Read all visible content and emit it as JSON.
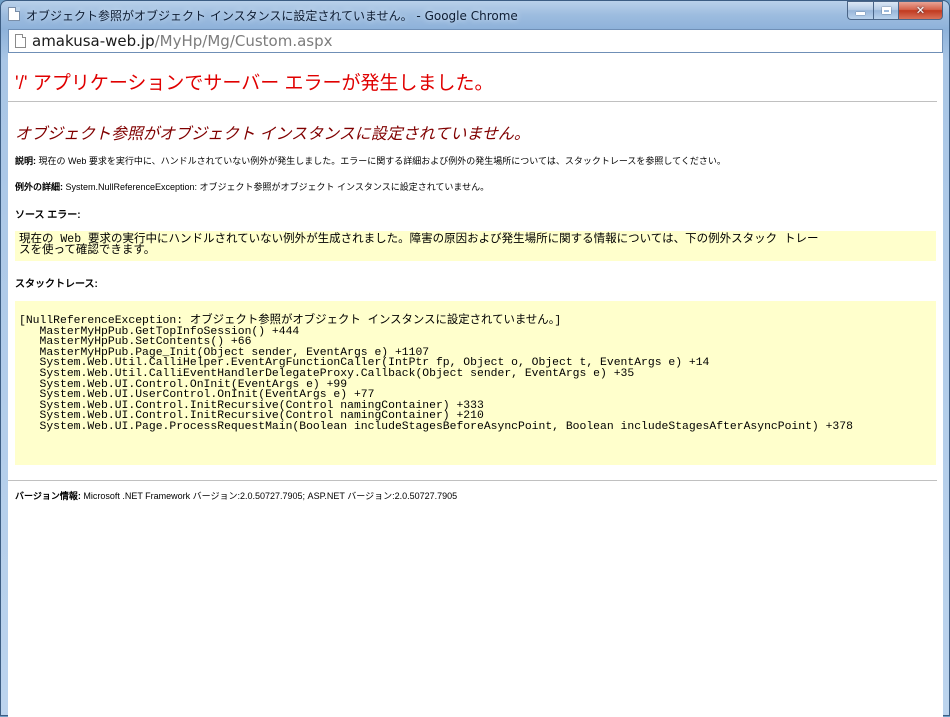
{
  "window": {
    "title": "オブジェクト参照がオブジェクト インスタンスに設定されていません。 - Google Chrome"
  },
  "address_bar": {
    "host": "amakusa-web.jp",
    "path": "/MyHp/Mg/Custom.aspx"
  },
  "page": {
    "server_error_title": "'/' アプリケーションでサーバー エラーが発生しました。",
    "error_message": "オブジェクト参照がオブジェクト インスタンスに設定されていません。",
    "description_label": "説明:",
    "description_text": " 現在の Web 要求を実行中に、ハンドルされていない例外が発生しました。エラーに関する詳細および例外の発生場所については、スタックトレースを参照してください。",
    "exception_label": "例外の詳細:",
    "exception_text": " System.NullReferenceException: オブジェクト参照がオブジェクト インスタンスに設定されていません。",
    "source_error_label": "ソース エラー:",
    "source_error_lines": [
      "現在の Web 要求の実行中にハンドルされていない例外が生成されました。障害の原因および発生場所に関する情報については、下の例外スタック トレー",
      "スを使って確認できます。"
    ],
    "stack_trace_label": "スタックトレース:",
    "stack_trace_lines": [
      "[NullReferenceException: オブジェクト参照がオブジェクト インスタンスに設定されていません。]",
      "   MasterMyHpPub.GetTopInfoSession() +444",
      "   MasterMyHpPub.SetContents() +66",
      "   MasterMyHpPub.Page_Init(Object sender, EventArgs e) +1107",
      "   System.Web.Util.CalliHelper.EventArgFunctionCaller(IntPtr fp, Object o, Object t, EventArgs e) +14",
      "   System.Web.Util.CalliEventHandlerDelegateProxy.Callback(Object sender, EventArgs e) +35",
      "   System.Web.UI.Control.OnInit(EventArgs e) +99",
      "   System.Web.UI.UserControl.OnInit(EventArgs e) +77",
      "   System.Web.UI.Control.InitRecursive(Control namingContainer) +333",
      "   System.Web.UI.Control.InitRecursive(Control namingContainer) +210",
      "   System.Web.UI.Page.ProcessRequestMain(Boolean includeStagesBeforeAsyncPoint, Boolean includeStagesAfterAsyncPoint) +378"
    ],
    "version_label": "バージョン情報:",
    "version_text": " Microsoft .NET Framework バージョン:2.0.50727.7905; ASP.NET バージョン:2.0.50727.7905"
  },
  "colors": {
    "error_title": "#e00000",
    "error_message": "#800000",
    "code_background": "#ffffcc"
  }
}
